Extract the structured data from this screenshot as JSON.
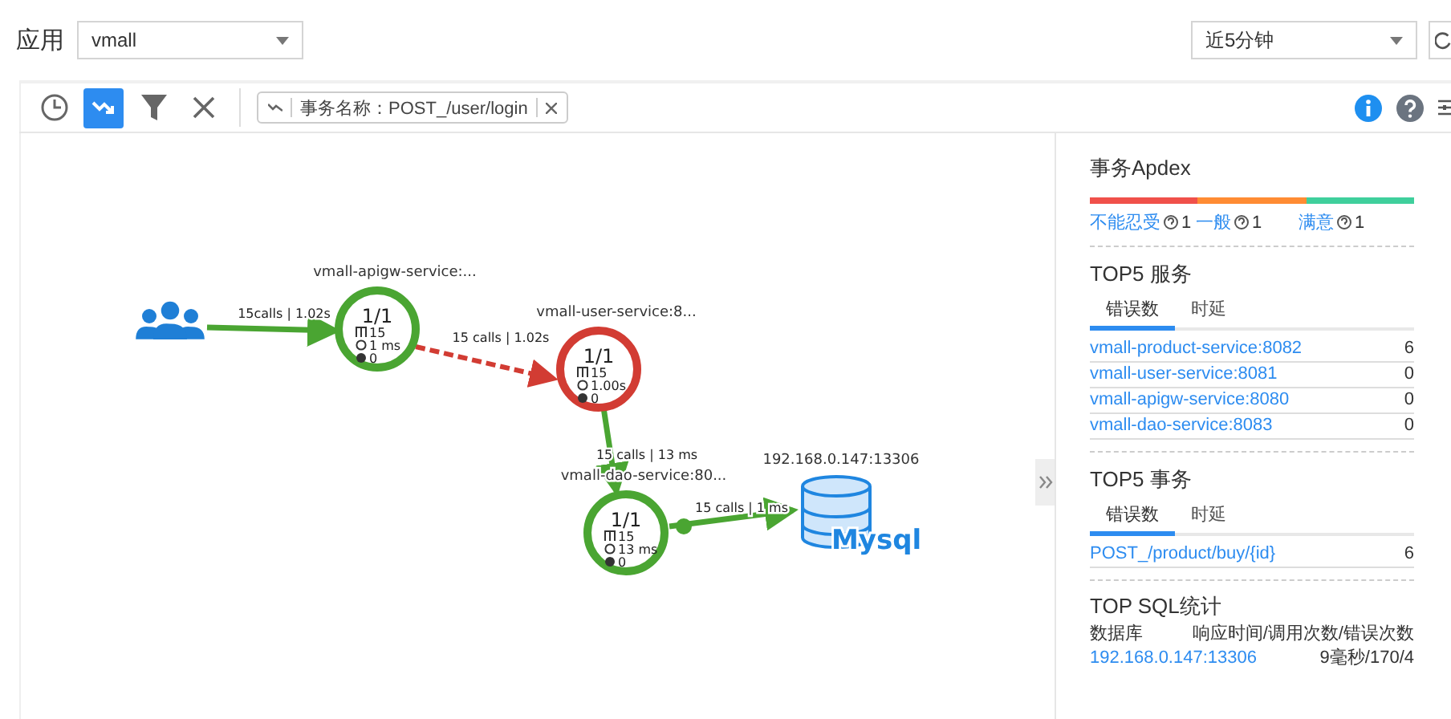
{
  "app": {
    "label": "应用",
    "value": "vmall"
  },
  "time_range": {
    "value": "近5分钟"
  },
  "toolbar": {
    "tools": [
      {
        "kind": "clock",
        "selected": false
      },
      {
        "kind": "topology",
        "selected": true
      },
      {
        "kind": "filter",
        "selected": false
      },
      {
        "kind": "clear",
        "selected": false
      }
    ],
    "filter_tag": {
      "text": "事务名称：POST_/user/login"
    },
    "right_tools": [
      {
        "kind": "info"
      },
      {
        "kind": "help"
      },
      {
        "kind": "settings"
      }
    ]
  },
  "graph": {
    "nodes": [
      {
        "kind": "users"
      },
      {
        "kind": "service",
        "title": "vmall-apigw-service:...",
        "ratio": "1/1",
        "count": "15",
        "latency": "1 ms",
        "errors": "0",
        "error": false
      },
      {
        "kind": "service",
        "title": "vmall-user-service:8...",
        "ratio": "1/1",
        "count": "15",
        "latency": "1.00s",
        "errors": "0",
        "error": true
      },
      {
        "kind": "service",
        "title": "vmall-dao-service:80...",
        "ratio": "1/1",
        "count": "15",
        "latency": "13 ms",
        "errors": "0",
        "error": false
      },
      {
        "kind": "database",
        "title": "192.168.0.147:13306",
        "name": "Mysql"
      }
    ],
    "edges": [
      {
        "label": "15calls | 1.02s",
        "error": false
      },
      {
        "label": "15 calls | 1.02s",
        "error": true
      },
      {
        "label": "15 calls | 13 ms",
        "error": false
      },
      {
        "label": "15 calls | 1 ms",
        "error": false
      }
    ]
  },
  "apdex": {
    "title": "事务Apdex",
    "segments": [
      {
        "label": "不能忍受",
        "count": "1",
        "color": "#f0504a"
      },
      {
        "label": "一般",
        "count": "1",
        "color": "#ff8c33"
      },
      {
        "label": "满意",
        "count": "1",
        "color": "#3fcf9c"
      }
    ]
  },
  "top5_services": {
    "title": "TOP5 服务",
    "tabs": [
      {
        "label": "错误数",
        "selected": true
      },
      {
        "label": "时延",
        "selected": false
      }
    ],
    "rows": [
      {
        "name": "vmall-product-service:8082",
        "value": "6"
      },
      {
        "name": "vmall-user-service:8081",
        "value": "0"
      },
      {
        "name": "vmall-apigw-service:8080",
        "value": "0"
      },
      {
        "name": "vmall-dao-service:8083",
        "value": "0"
      }
    ]
  },
  "top5_transactions": {
    "title": "TOP5 事务",
    "tabs": [
      {
        "label": "错误数",
        "selected": true
      },
      {
        "label": "时延",
        "selected": false
      }
    ],
    "rows": [
      {
        "name": "POST_/product/buy/{id}",
        "value": "6"
      }
    ]
  },
  "top_sql": {
    "title": "TOP SQL统计",
    "columns": [
      "数据库",
      "响应时间/调用次数/错误次数"
    ],
    "rows": [
      {
        "database": "192.168.0.147:13306",
        "stats": "9毫秒/170/4"
      }
    ]
  }
}
